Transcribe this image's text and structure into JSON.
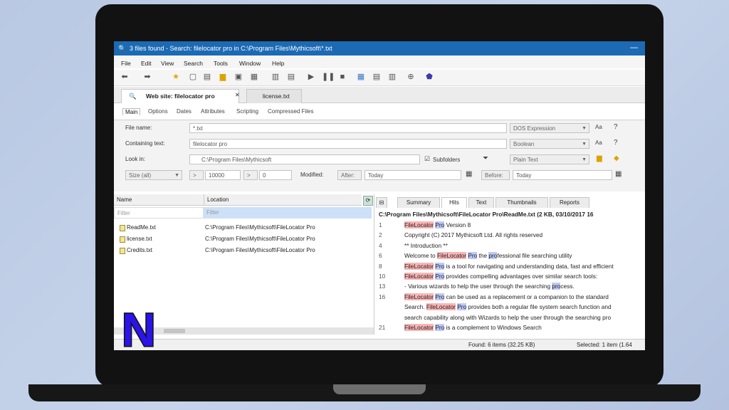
{
  "window": {
    "title": "3 files found - Search: filelocator pro in C:\\Program Files\\Mythicsoft\\*.txt",
    "min_glyph": "—"
  },
  "menu": [
    "File",
    "Edit",
    "View",
    "Search",
    "Tools",
    "Window",
    "Help"
  ],
  "tabs": [
    {
      "label": "Web site: filelocator pro"
    },
    {
      "label": "license.txt"
    }
  ],
  "tab_close_glyph": "✕",
  "subtabs": [
    "Main",
    "Options",
    "Dates",
    "Attributes",
    "Scripting",
    "Compressed Files"
  ],
  "form": {
    "file_name": {
      "label": "File name:",
      "value": "*.txt",
      "mode": "DOS Expression"
    },
    "containing_text": {
      "label": "Containing text:",
      "value": "filelocator pro",
      "mode": "Boolean"
    },
    "look_in": {
      "label": "Look in:",
      "value": "C:\\Program Files\\Mythicsoft",
      "subfolders": "Subfolders",
      "mode": "Plain Text"
    },
    "size": {
      "mode": "Size (all)",
      "op": ">",
      "value1": "10000",
      "value2": "0"
    },
    "modified": {
      "label": "Modified:",
      "after": "After:",
      "after_value": "Today",
      "before": "Before:",
      "before_value": "Today"
    },
    "aa_glyph": "Aa",
    "help_glyph": "?"
  },
  "results": {
    "headers": {
      "name": "Name",
      "location": "Location"
    },
    "filter": {
      "name": "Filter",
      "location": "Filter"
    },
    "rows": [
      {
        "name": "ReadMe.txt",
        "location": "C:\\Program Files\\Mythicsoft\\FileLocator Pro"
      },
      {
        "name": "license.txt",
        "location": "C:\\Program Files\\Mythicsoft\\FileLocator Pro"
      },
      {
        "name": "Credits.txt",
        "location": "C:\\Program Files\\Mythicsoft\\FileLocator Pro"
      }
    ]
  },
  "preview": {
    "tabs": [
      "Summary",
      "Hits",
      "Text",
      "Thumbnails",
      "Reports"
    ],
    "path": "C:\\Program Files\\Mythicsoft\\FileLocator Pro\\ReadMe.txt  (2 KB, 03/10/2017 16",
    "lines": [
      {
        "no": "1",
        "parts": [
          {
            "t": "FileLocator",
            "h": "a"
          },
          {
            "t": " "
          },
          {
            "t": "Pro",
            "h": "b"
          },
          {
            "t": " Version 8"
          }
        ]
      },
      {
        "no": "2",
        "parts": [
          {
            "t": "Copyright (C) 2017 Mythicsoft Ltd. All rights reserved"
          }
        ]
      },
      {
        "no": "4",
        "parts": [
          {
            "t": "** Introduction **"
          }
        ]
      },
      {
        "no": "6",
        "parts": [
          {
            "t": "Welcome to "
          },
          {
            "t": "FileLocator",
            "h": "a"
          },
          {
            "t": " "
          },
          {
            "t": "Pro",
            "h": "b"
          },
          {
            "t": " the "
          },
          {
            "t": "pro",
            "h": "b"
          },
          {
            "t": "fessional file searching utility"
          }
        ]
      },
      {
        "no": "8",
        "parts": [
          {
            "t": "FileLocator",
            "h": "a"
          },
          {
            "t": " "
          },
          {
            "t": "Pro",
            "h": "b"
          },
          {
            "t": " is a tool for navigating and understanding data, fast and efficient"
          }
        ]
      },
      {
        "no": "10",
        "parts": [
          {
            "t": "FileLocator",
            "h": "a"
          },
          {
            "t": " "
          },
          {
            "t": "Pro",
            "h": "b"
          },
          {
            "t": " provides compelling advantages over similar search tools:"
          }
        ]
      },
      {
        "no": "13",
        "parts": [
          {
            "t": "- Various wizards to help the user through the searching "
          },
          {
            "t": "pro",
            "h": "b"
          },
          {
            "t": "cess."
          }
        ]
      },
      {
        "no": "16",
        "parts": [
          {
            "t": "FileLocator",
            "h": "a"
          },
          {
            "t": " "
          },
          {
            "t": "Pro",
            "h": "b"
          },
          {
            "t": " can be used as a replacement or a companion to the standard"
          }
        ]
      },
      {
        "no": "",
        "parts": [
          {
            "t": "Search. "
          },
          {
            "t": "FileLocator",
            "h": "a"
          },
          {
            "t": " "
          },
          {
            "t": "Pro",
            "h": "b"
          },
          {
            "t": " provides both a regular file system search function and"
          }
        ]
      },
      {
        "no": "",
        "parts": [
          {
            "t": "search capability along with Wizards to help the user through the searching pro"
          }
        ]
      },
      {
        "no": "21",
        "parts": [
          {
            "t": "FileLocator",
            "h": "a"
          },
          {
            "t": " "
          },
          {
            "t": "Pro",
            "h": "b"
          },
          {
            "t": " is a complement to Windows Search"
          }
        ]
      }
    ]
  },
  "status": {
    "found": "Found: 6 items (32.25 KB)",
    "selected": "Selected: 1 item (1.64"
  },
  "logo_letter": "N",
  "colors": {
    "titlebar": "#1c6ab4",
    "highlight_a": "#f9b4b4",
    "highlight_b": "#bfc9f7",
    "logo_fill": "#2a14e8"
  }
}
